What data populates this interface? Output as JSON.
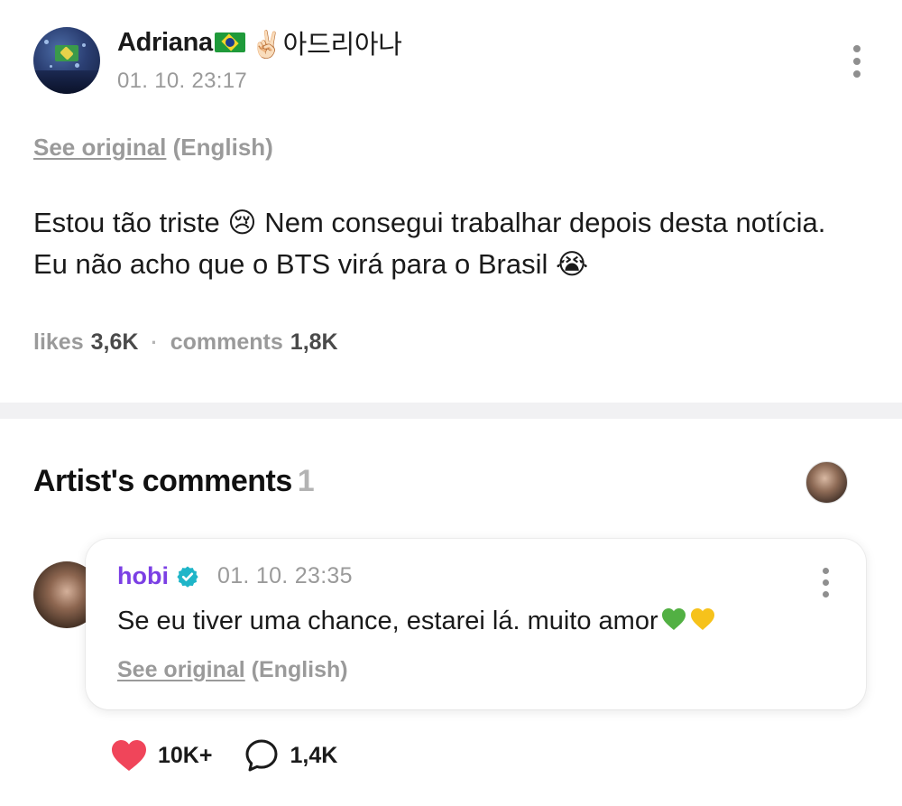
{
  "post": {
    "author_name": "Adriana",
    "author_name_suffix": "✌🏻아드리아나",
    "timestamp": "01. 10. 23:17",
    "translate_link": "See original",
    "translate_lang": "(English)",
    "body": "Estou tão triste 😢 Nem consegui trabalhar depois desta notícia. Eu não acho que o BTS virá para o Brasil 😭",
    "likes_label": "likes",
    "likes_count": "3,6K",
    "comments_label": "comments",
    "comments_count": "1,8K",
    "separator": "·"
  },
  "artist_comments": {
    "title": "Artist's comments",
    "count": "1",
    "comment": {
      "author": "hobi",
      "timestamp": "01. 10. 23:35",
      "body": "Se eu tiver uma chance, estarei lá. muito amor",
      "translate_link": "See original",
      "translate_lang": "(English)",
      "likes": "10K+",
      "replies": "1,4K"
    }
  },
  "icons": {
    "more": "kebab-icon",
    "verified": "verified-badge-icon",
    "like": "heart-icon",
    "reply": "speech-bubble-icon"
  },
  "colors": {
    "artist_name": "#7b3fe4",
    "verified": "#1fb5c8",
    "heart": "#f0455a",
    "muted_text": "#9a9a9a"
  }
}
